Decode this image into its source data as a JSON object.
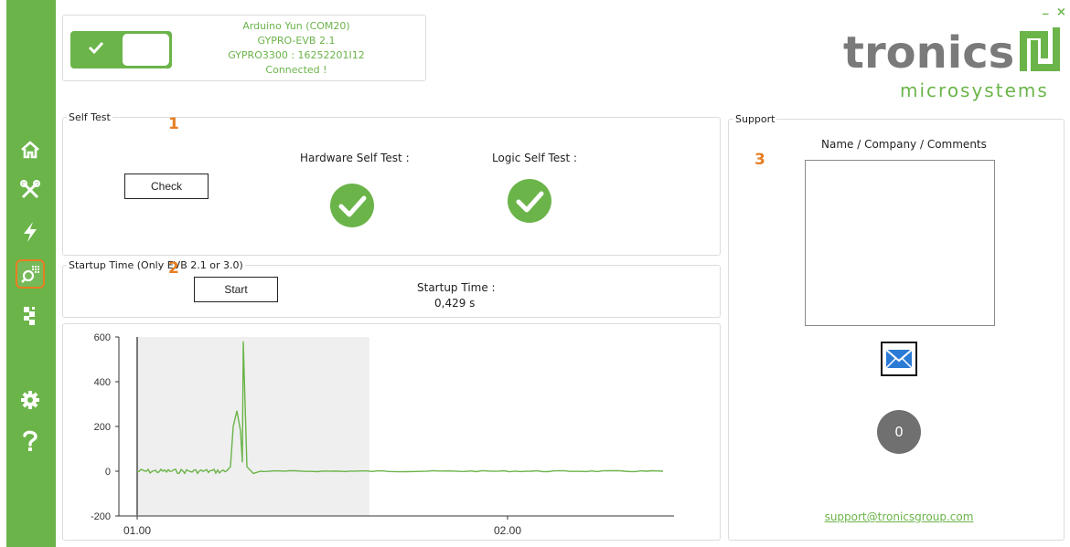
{
  "connection": {
    "line1": "Arduino Yun (COM20)",
    "line2": "GYPRO-EVB 2.1",
    "line3": "GYPRO3300 : 16252201I12",
    "line4": "Connected !",
    "toggle_state": "on"
  },
  "window": {
    "minimize": "_",
    "close": "×"
  },
  "brand": {
    "name": "tronics",
    "sub": "microsystems",
    "color": "#6bb44a",
    "text_color": "#7a7a7a"
  },
  "sidebar": {
    "items": [
      {
        "id": "home",
        "icon": "home-icon"
      },
      {
        "id": "tools",
        "icon": "tools-icon"
      },
      {
        "id": "power",
        "icon": "lightning-icon"
      },
      {
        "id": "diagnostics",
        "icon": "search-chip-icon",
        "active": true
      },
      {
        "id": "modules",
        "icon": "puzzle-icon"
      },
      {
        "id": "settings",
        "icon": "gear-icon"
      },
      {
        "id": "help",
        "icon": "help-icon"
      }
    ]
  },
  "self_test": {
    "title": "Self Test",
    "marker": "1",
    "check_button": "Check",
    "hardware_label": "Hardware Self Test :",
    "logic_label": "Logic Self Test :",
    "hardware_status": "pass",
    "logic_status": "pass"
  },
  "startup": {
    "title": "Startup Time (Only EVB 2.1 or 3.0)",
    "marker": "2",
    "start_button": "Start",
    "time_label": "Startup Time :",
    "time_value": "0,429 s"
  },
  "support": {
    "title": "Support",
    "marker": "3",
    "field_label": "Name / Company / Comments",
    "comments_value": "",
    "send_icon": "mail-icon",
    "counter": "0",
    "email": "support@tronicsgroup.com"
  },
  "chart_data": {
    "type": "line",
    "ylim": [
      -200,
      600
    ],
    "yticks": [
      "600",
      "400",
      "200",
      "0",
      "-200"
    ],
    "xticks": [
      "01.00",
      "02.00"
    ],
    "series": [
      {
        "color": "#6bb44a"
      }
    ],
    "highlight_region": {
      "x_start": 0.0,
      "x_end": 0.44
    }
  }
}
